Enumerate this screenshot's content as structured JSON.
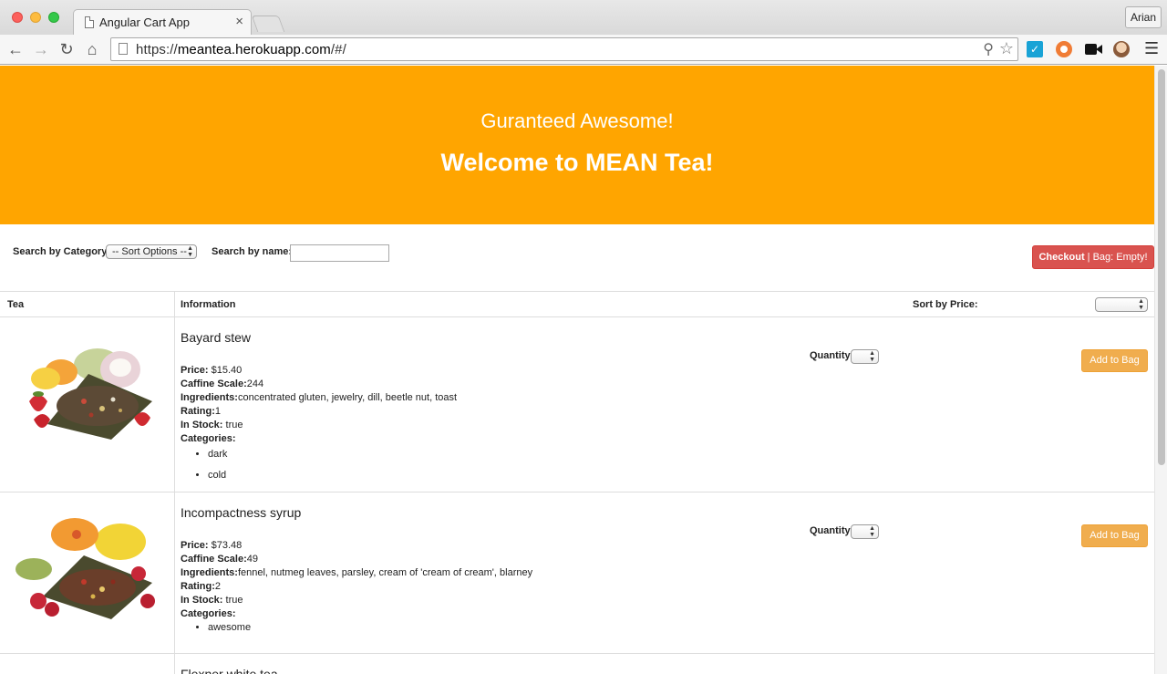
{
  "browser": {
    "tab_title": "Angular Cart App",
    "tab_close": "×",
    "profile": "Arian",
    "url_scheme": "https://",
    "url_host": "meantea.herokuapp.com",
    "url_path": "/#/"
  },
  "header": {
    "tagline": "Guranteed Awesome!",
    "welcome": "Welcome to MEAN Tea!",
    "color": "#ffa500"
  },
  "filters": {
    "category_label": "Search by Category",
    "category_select": "-- Sort Options --",
    "name_label": "Search by name:",
    "name_value": ""
  },
  "checkout": {
    "label": "Checkout",
    "bag": "Bag: Empty!",
    "color": "#d9534f"
  },
  "table": {
    "col_tea": "Tea",
    "col_info": "Information",
    "sort_label": "Sort by Price:",
    "sort_value": ""
  },
  "labels": {
    "price": "Price:",
    "caffeine": "Caffine Scale:",
    "ingredients": "Ingredients:",
    "rating": "Rating:",
    "in_stock": "In Stock:",
    "categories": "Categories:",
    "quantity": "Quantity",
    "add_to_bag": "Add to Bag"
  },
  "teas": [
    {
      "name": "Bayard stew",
      "price": "$15.40",
      "caffeine": "244",
      "ingredients": "concentrated gluten, jewelry, dill, beetle nut, toast",
      "rating": "1",
      "in_stock": "true",
      "categories": [
        "dark",
        "cold"
      ],
      "image": "tea-with-strawberries-and-dragonfruit"
    },
    {
      "name": "Incompactness syrup",
      "price": "$73.48",
      "caffeine": "49",
      "ingredients": "fennel, nutmeg leaves, parsley, cream of 'cream of cream', blarney",
      "rating": "2",
      "in_stock": "true",
      "categories": [
        "awesome"
      ],
      "image": "tea-with-hibiscus-and-raspberries"
    },
    {
      "name": "Flexner white tea"
    }
  ]
}
